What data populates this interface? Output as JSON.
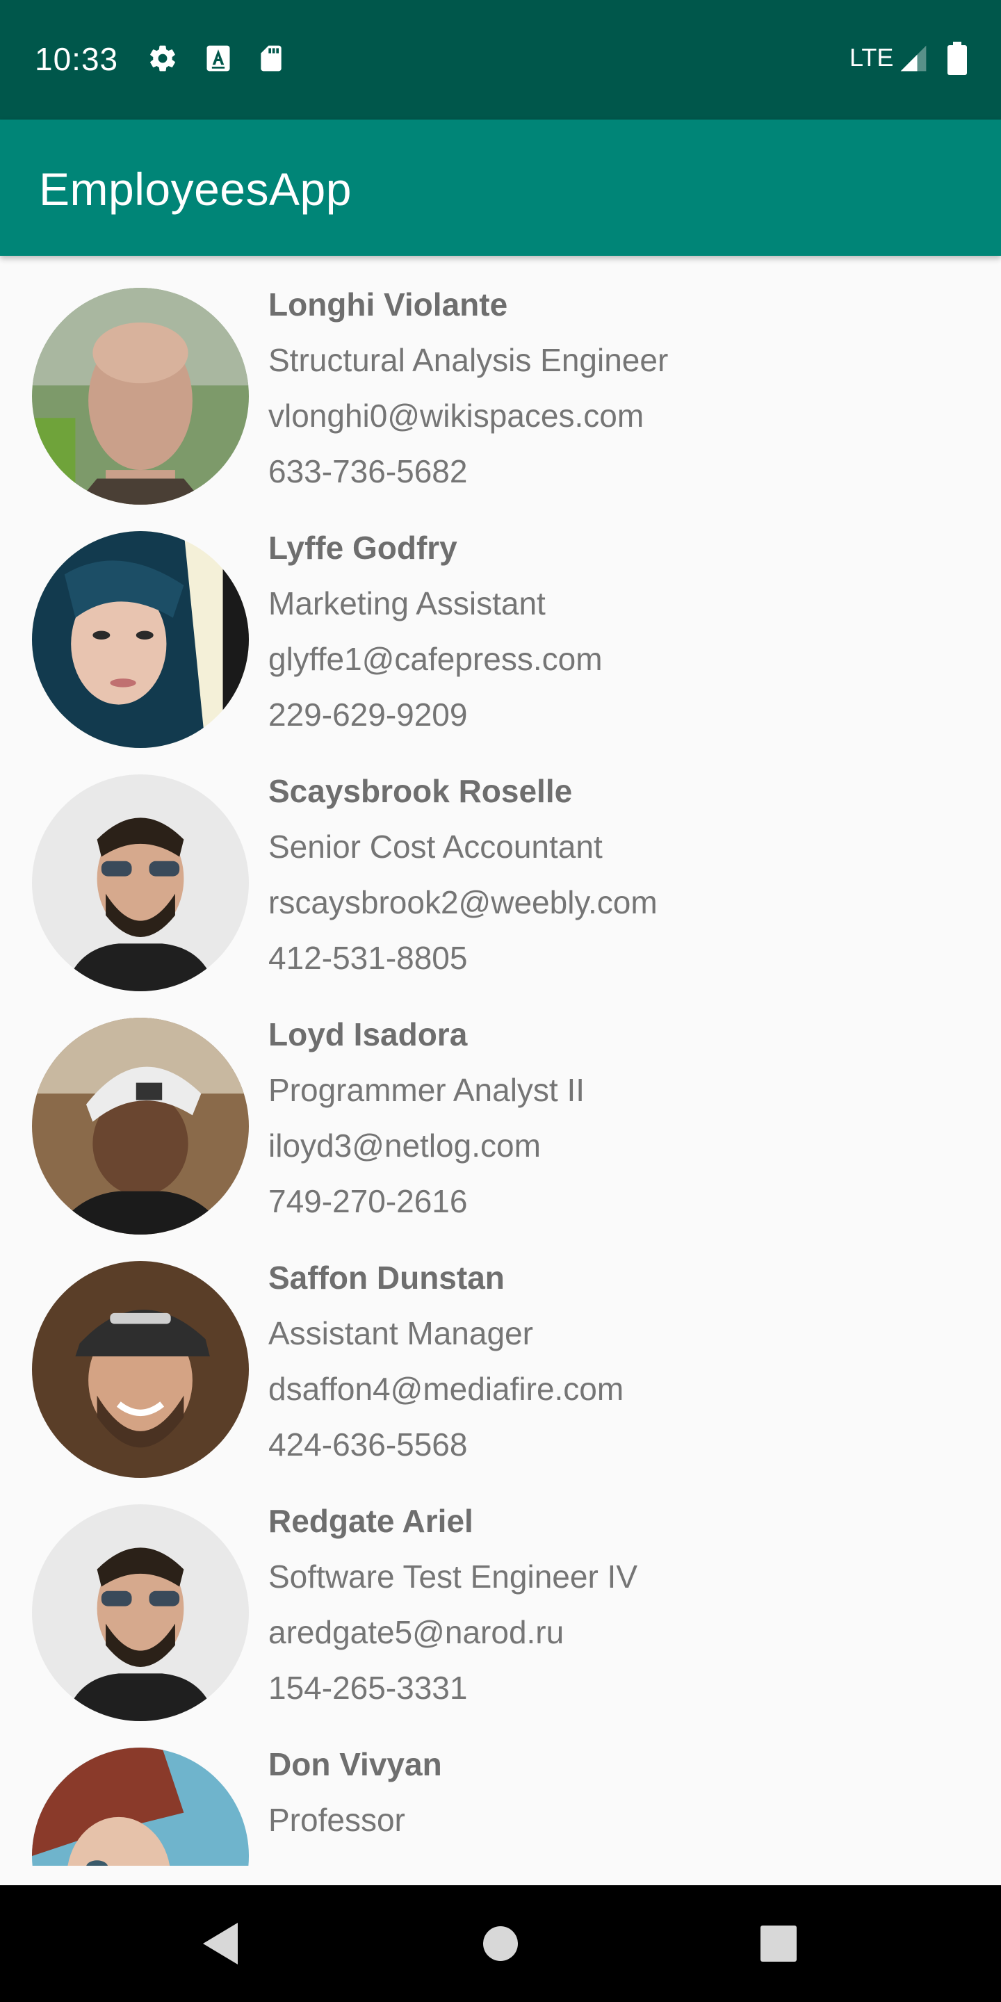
{
  "status_bar": {
    "time": "10:33",
    "network": "LTE",
    "icons": [
      "settings-icon",
      "font-a-icon",
      "sd-card-icon",
      "signal-icon",
      "battery-icon"
    ]
  },
  "app_bar": {
    "title": "EmployeesApp",
    "color": "#008577"
  },
  "employees": [
    {
      "name": "Longhi Violante",
      "title": "Structural Analysis Engineer",
      "email": "vlonghi0@wikispaces.com",
      "phone": "633-736-5682"
    },
    {
      "name": "Lyffe Godfry",
      "title": "Marketing Assistant",
      "email": "glyffe1@cafepress.com",
      "phone": "229-629-9209"
    },
    {
      "name": "Scaysbrook Roselle",
      "title": "Senior Cost Accountant",
      "email": "rscaysbrook2@weebly.com",
      "phone": "412-531-8805"
    },
    {
      "name": "Loyd Isadora",
      "title": "Programmer Analyst II",
      "email": "iloyd3@netlog.com",
      "phone": "749-270-2616"
    },
    {
      "name": "Saffon Dunstan",
      "title": "Assistant Manager",
      "email": "dsaffon4@mediafire.com",
      "phone": "424-636-5568"
    },
    {
      "name": "Redgate Ariel",
      "title": "Software Test Engineer IV",
      "email": "aredgate5@narod.ru",
      "phone": "154-265-3331"
    },
    {
      "name": "Don Vivyan",
      "title": "Professor",
      "email": "",
      "phone": ""
    }
  ],
  "nav_bar": {
    "icons": [
      "back-icon",
      "home-icon",
      "recent-apps-icon"
    ]
  }
}
